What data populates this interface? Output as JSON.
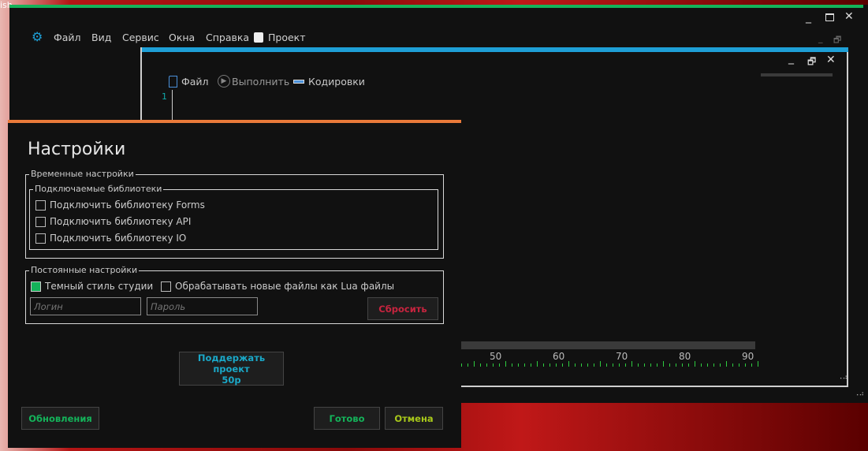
{
  "desktop": {
    "label": "ish"
  },
  "main_menu": {
    "items": [
      "Файл",
      "Вид",
      "Сервис",
      "Окна",
      "Справка"
    ],
    "project": "Проект"
  },
  "editor": {
    "toolbar": {
      "file": "Файл",
      "run": "Выполнить",
      "encodings": "Кодировки"
    },
    "line_number": "1",
    "ruler": {
      "labels": [
        "50",
        "60",
        "70",
        "80",
        "90"
      ]
    }
  },
  "settings": {
    "title": "Настройки",
    "temp_group": "Временные настройки",
    "libs_group": "Подключаемые библиотеки",
    "libs": [
      {
        "label": "Подключить библиотеку Forms",
        "checked": false
      },
      {
        "label": "Подключить библиотеку API",
        "checked": false
      },
      {
        "label": "Подключить библиотеку IO",
        "checked": false
      }
    ],
    "perm_group": "Постоянные настройки",
    "dark_style": {
      "label": "Темный стиль студии",
      "checked": true
    },
    "lua_files": {
      "label": "Обрабатывать новые файлы как Lua файлы",
      "checked": false
    },
    "login_placeholder": "Логин",
    "password_placeholder": "Пароль",
    "reset": "Сбросить",
    "support_line1": "Поддержать проект",
    "support_line2": "50р",
    "updates": "Обновления",
    "done": "Готово",
    "cancel": "Отмена"
  },
  "colors": {
    "main_accent": "#14b35a",
    "editor_accent": "#1e9fd6",
    "dialog_accent": "#ea7a3a",
    "checked": "#14b35a"
  }
}
